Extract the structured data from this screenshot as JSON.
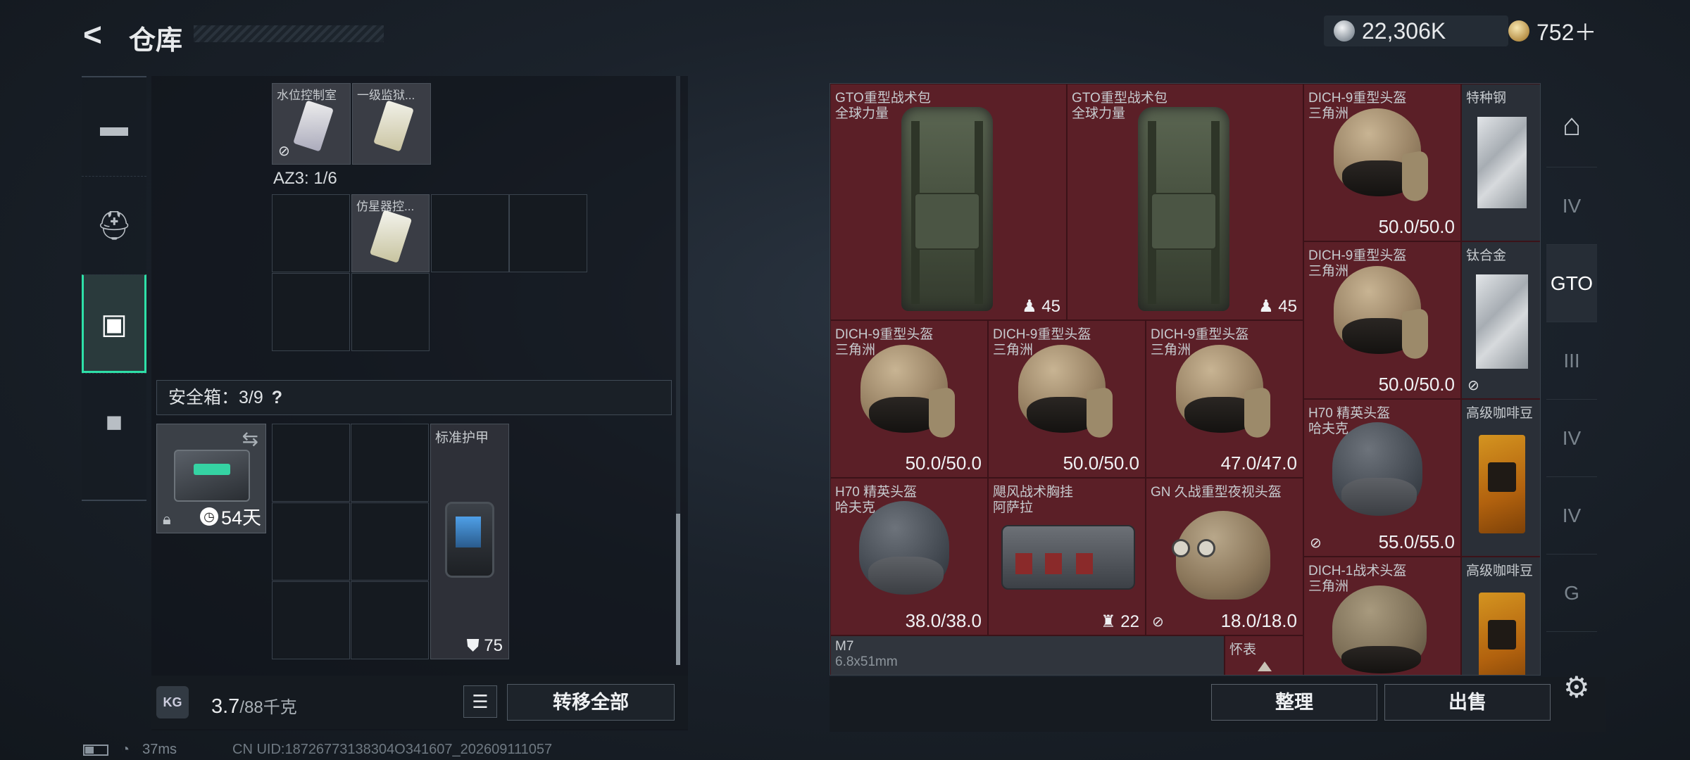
{
  "header": {
    "title": "仓库",
    "currency1": "22,306K",
    "currency2": "752＋"
  },
  "leftnav": {
    "items": [
      "pistol-icon",
      "backpack-icon",
      "rig-icon",
      "briefcase-icon"
    ]
  },
  "backpack": {
    "slot_items": [
      {
        "name": "水位控制室"
      },
      {
        "name": "一级监狱..."
      }
    ],
    "az3_label": "AZ3: 1/6",
    "az3_item": {
      "name": "仿星器控..."
    },
    "safebox_label": "安全箱：3/9",
    "safebox_help": "?",
    "safecase_days": "54天",
    "armor": {
      "name": "标准护甲",
      "value": "75"
    },
    "weight_value": "3.7",
    "weight_max": "/88千克",
    "transfer_all": "转移全部"
  },
  "status": {
    "ping": "37ms",
    "uid": "CN UID:18726773138304O341607_202609111057"
  },
  "stash": {
    "items": [
      {
        "name": "GTO重型战术包",
        "sub": "全球力量",
        "count": "45"
      },
      {
        "name": "GTO重型战术包",
        "sub": "全球力量",
        "count": "45"
      },
      {
        "name": "DICH-9重型头盔",
        "sub": "三角洲",
        "durability": "50.0/50.0"
      },
      {
        "name": "特种钢"
      },
      {
        "name": "DICH-9重型头盔",
        "sub": "三角洲",
        "durability": "50.0/50.0"
      },
      {
        "name": "钛合金"
      },
      {
        "name": "DICH-9重型头盔",
        "sub": "三角洲",
        "durability": "50.0/50.0"
      },
      {
        "name": "DICH-9重型头盔",
        "sub": "三角洲",
        "durability": "50.0/50.0"
      },
      {
        "name": "DICH-9重型头盔",
        "sub": "三角洲",
        "durability": "47.0/47.0"
      },
      {
        "name": "H70 精英头盔",
        "sub": "哈夫克",
        "durability": "55.0/55.0"
      },
      {
        "name": "高级咖啡豆"
      },
      {
        "name": "H70 精英头盔",
        "sub": "哈夫克",
        "durability": "38.0/38.0"
      },
      {
        "name": "飓风战术胸挂",
        "sub": "阿萨拉",
        "count": "22"
      },
      {
        "name": "GN 久战重型夜视头盔",
        "durability": "18.0/18.0"
      },
      {
        "name": "DICH-1战术头盔",
        "sub": "三角洲"
      },
      {
        "name": "高级咖啡豆"
      },
      {
        "name": "M7",
        "sub": "6.8x51mm"
      },
      {
        "name": "怀表"
      }
    ],
    "sort_btn": "整理",
    "sell_btn": "出售"
  },
  "rightnav": {
    "items": [
      "IV",
      "GTO",
      "III",
      "IV",
      "IV",
      "G"
    ]
  },
  "colors": {
    "accent": "#2ee0a8",
    "rare_red": "#5b1f27"
  }
}
